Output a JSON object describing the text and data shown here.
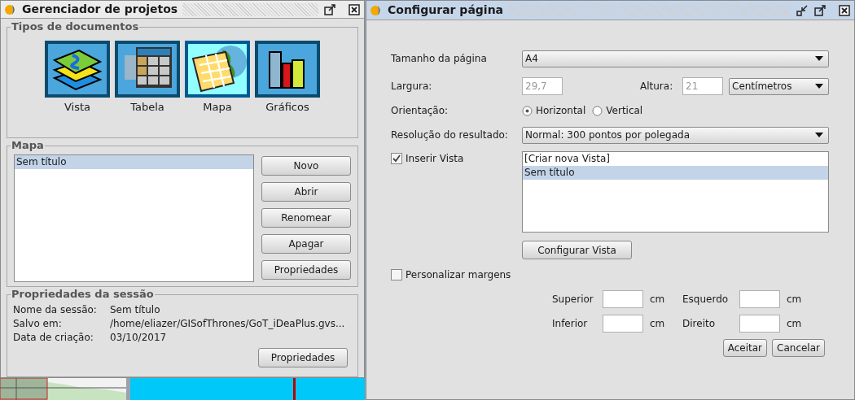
{
  "project_manager": {
    "title": "Gerenciador de projetos",
    "document_types": {
      "title": "Tipos de documentos",
      "items": [
        {
          "label": "Vista",
          "kind": "layers",
          "selected": false
        },
        {
          "label": "Tabela",
          "kind": "table",
          "selected": false
        },
        {
          "label": "Mapa",
          "kind": "map",
          "selected": true
        },
        {
          "label": "Gráficos",
          "kind": "chart",
          "selected": false
        }
      ]
    },
    "map_group": {
      "title": "Mapa",
      "list": [
        {
          "label": "Sem título",
          "selected": true
        }
      ],
      "buttons": [
        "Novo",
        "Abrir",
        "Renomear",
        "Apagar",
        "Propriedades"
      ]
    },
    "session": {
      "title": "Propriedades da sessão",
      "rows": [
        {
          "label": "Nome da sessão:",
          "value": "Sem título"
        },
        {
          "label": "Salvo em:",
          "value": "/home/eliazer/GISofThrones/GoT_iDeaPlus.gvs..."
        },
        {
          "label": "Data de criação:",
          "value": "03/10/2017"
        }
      ],
      "button": "Propriedades"
    }
  },
  "page_setup": {
    "title": "Configurar página",
    "page_size": {
      "label": "Tamanho da página",
      "value": "A4"
    },
    "width": {
      "label": "Largura:",
      "value": "29,7",
      "disabled": true
    },
    "height": {
      "label": "Altura:",
      "value": "21",
      "disabled": true
    },
    "units": {
      "value": "Centímetros"
    },
    "orientation": {
      "label": "Orientação:",
      "options": [
        {
          "label": "Horizontal",
          "selected": true
        },
        {
          "label": "Vertical",
          "selected": false
        }
      ]
    },
    "resolution": {
      "label": "Resolução do resultado:",
      "value": "Normal: 300 pontos por polegada"
    },
    "insert_view": {
      "label": "Inserir Vista",
      "checked": true
    },
    "views": [
      {
        "label": "[Criar nova Vista]",
        "selected": false
      },
      {
        "label": "Sem título",
        "selected": true
      }
    ],
    "configure_view_button": "Configurar Vista",
    "custom_margins": {
      "label": "Personalizar margens",
      "checked": false
    },
    "margins": [
      {
        "label": "Superior",
        "unit": "cm"
      },
      {
        "label": "Esquerdo",
        "unit": "cm"
      },
      {
        "label": "Inferior",
        "unit": "cm"
      },
      {
        "label": "Direito",
        "unit": "cm"
      }
    ],
    "buttons": [
      "Aceitar",
      "Cancelar"
    ]
  }
}
